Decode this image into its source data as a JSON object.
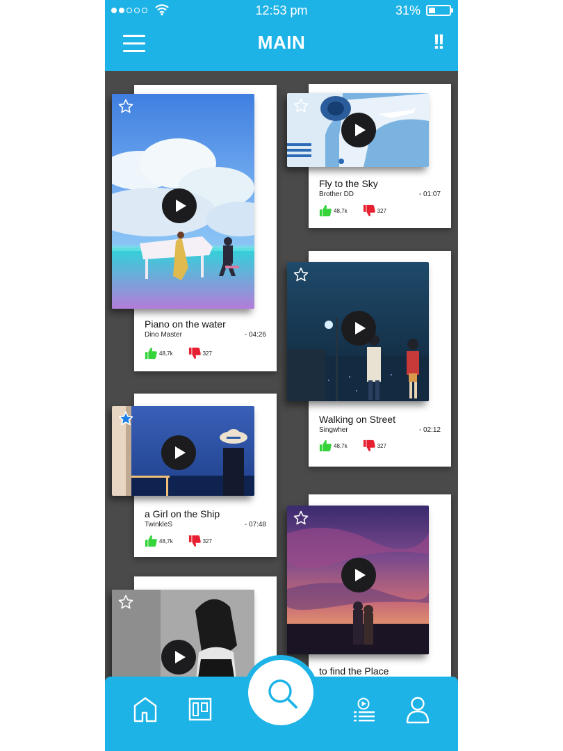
{
  "status_bar": {
    "time": "12:53 pm",
    "battery_percent": "31%",
    "battery_level": 0.31,
    "signal_bars": 2,
    "signal_total": 5
  },
  "header": {
    "title": "MAIN",
    "alert_label": "!!"
  },
  "colors": {
    "accent": "#1eb3e6",
    "like": "#35d43b",
    "dislike": "#e62030"
  },
  "cards": [
    {
      "title": "Piano on the water",
      "artist": "Dino Master",
      "duration": "- 04:26",
      "likes": "48,7k",
      "dislikes": "327",
      "starred": false
    },
    {
      "title": "Fly to the Sky",
      "artist": "Brother DD",
      "duration": "- 01:07",
      "likes": "48,7k",
      "dislikes": "327",
      "starred": false
    },
    {
      "title": "Walking on Street",
      "artist": "Singwher",
      "duration": "- 02:12",
      "likes": "48,7k",
      "dislikes": "327",
      "starred": false
    },
    {
      "title": "a Girl on the Ship",
      "artist": "TwinkleS",
      "duration": "- 07:48",
      "likes": "48,7k",
      "dislikes": "327",
      "starred": true
    },
    {
      "title": "to find the Place",
      "artist": "",
      "duration": "",
      "likes": "",
      "dislikes": "",
      "starred": false
    },
    {
      "title": "",
      "artist": "",
      "duration": "",
      "likes": "",
      "dislikes": "",
      "starred": false
    }
  ],
  "nav": {
    "icons": [
      "home-icon",
      "board-icon",
      "search-icon",
      "playlist-icon",
      "profile-icon"
    ]
  }
}
